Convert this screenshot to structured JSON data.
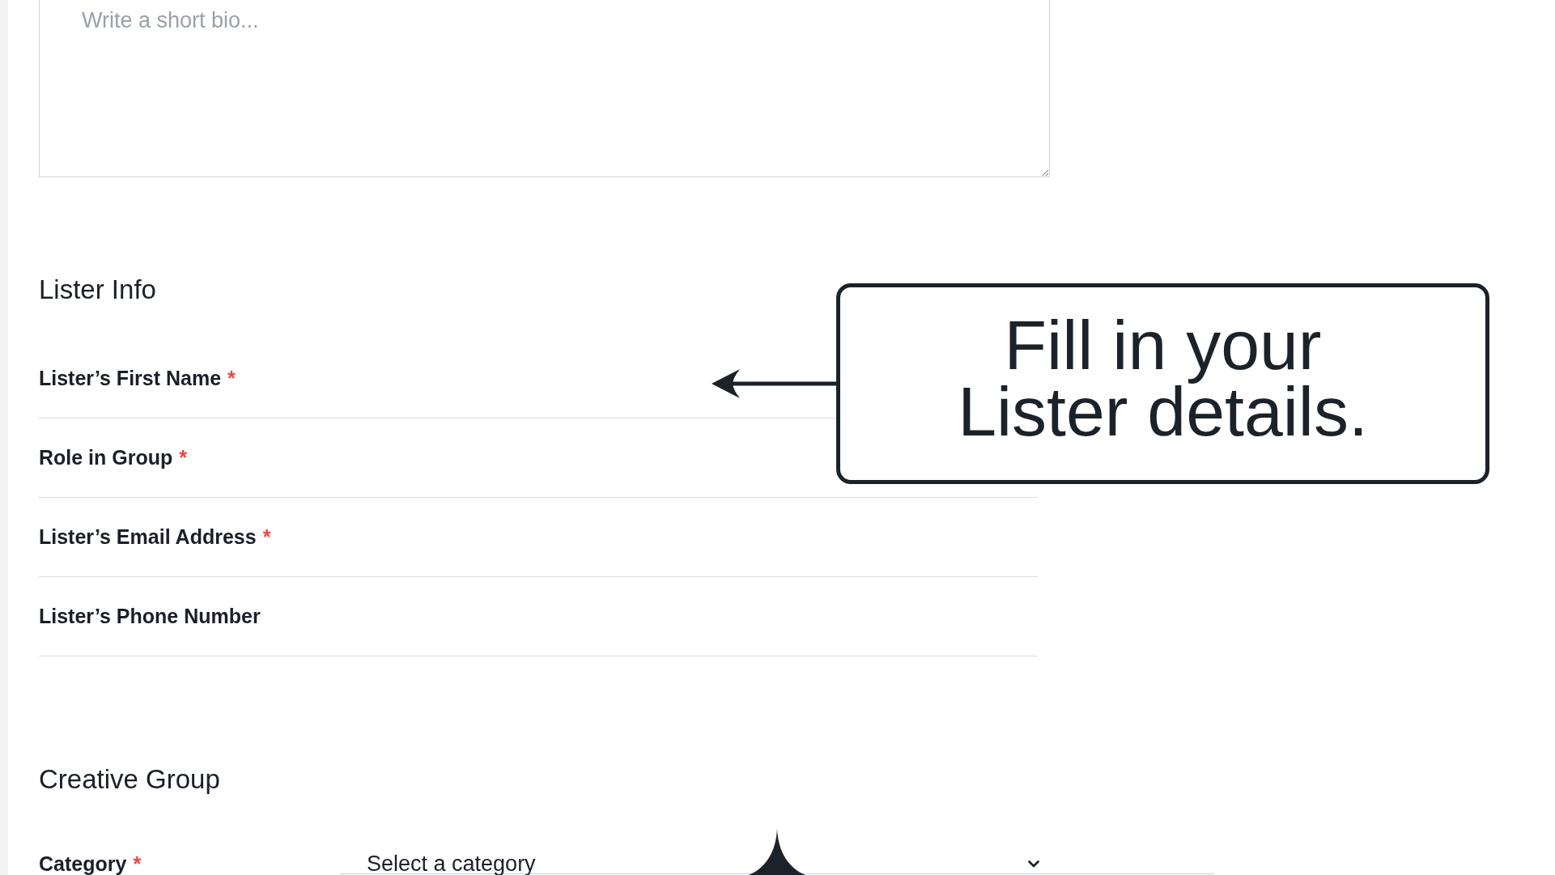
{
  "bio": {
    "placeholder": "Write a short bio..."
  },
  "sections": [
    {
      "title": "Lister Info",
      "fields": [
        {
          "kind": "text",
          "label": "Lister’s First Name",
          "required_mark": "*"
        },
        {
          "kind": "text",
          "label": "Role in Group",
          "required_mark": "*"
        },
        {
          "kind": "text",
          "label": "Lister’s Email Address",
          "required_mark": "*"
        },
        {
          "kind": "text",
          "label": "Lister’s Phone Number"
        }
      ]
    },
    {
      "title": "Creative Group",
      "fields": [
        {
          "kind": "dropdown",
          "label": "Category",
          "required_mark": "*",
          "placeholder": "Select a category"
        }
      ]
    }
  ],
  "callout": {
    "text": "Fill in your Lister details."
  }
}
